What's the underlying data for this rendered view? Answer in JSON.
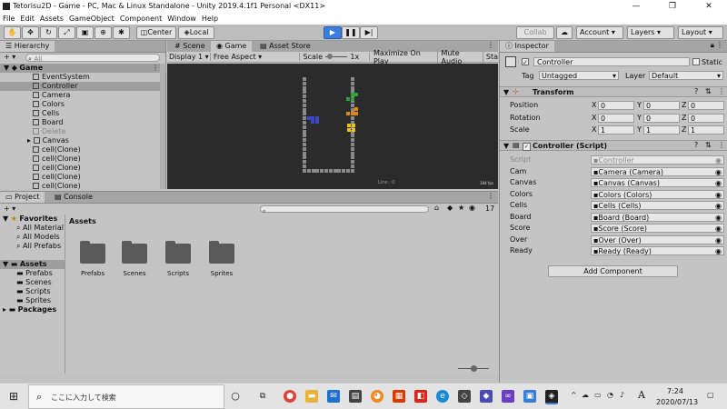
{
  "window": {
    "title": "Tetorisu2D - Game - PC, Mac & Linux Standalone - Unity 2019.4.1f1 Personal <DX11>"
  },
  "menu": [
    "File",
    "Edit",
    "Assets",
    "GameObject",
    "Component",
    "Window",
    "Help"
  ],
  "toolbar": {
    "center_label": "Center",
    "local_label": "Local",
    "collab_label": "Collab",
    "account_label": "Account",
    "layers_label": "Layers",
    "layout_label": "Layout"
  },
  "hierarchy": {
    "tab": "Hierarchy",
    "search_placeholder": "All",
    "scene": "Game",
    "items": [
      "EventSystem",
      "Controller",
      "Camera",
      "Colors",
      "Cells",
      "Board",
      "Delete",
      "Canvas",
      "cell(Clone)",
      "cell(Clone)",
      "cell(Clone)",
      "cell(Clone)",
      "cell(Clone)"
    ]
  },
  "center_tabs": {
    "scene": "Scene",
    "game": "Game",
    "store": "Asset Store"
  },
  "game_toolbar": {
    "display": "Display 1",
    "aspect": "Free Aspect",
    "scale_label": "Scale",
    "scale_value": "1x",
    "maximize": "Maximize On Play",
    "mute": "Mute Audio",
    "stats": "Sta"
  },
  "game_view": {
    "line_text": "Line : 0",
    "fps_text": "184 fps"
  },
  "project": {
    "tab": "Project",
    "console_tab": "Console",
    "count": "17",
    "favorites": {
      "label": "Favorites",
      "items": [
        "All Material",
        "All Models",
        "All Prefabs"
      ]
    },
    "assets_label": "Assets",
    "asset_tree": [
      "Prefabs",
      "Scenes",
      "Scripts",
      "Sprites"
    ],
    "packages_label": "Packages",
    "grid_header": "Assets",
    "folders": [
      "Prefabs",
      "Scenes",
      "Scripts",
      "Sprites"
    ]
  },
  "inspector": {
    "tab": "Inspector",
    "object_name": "Controller",
    "static_label": "Static",
    "tag_label": "Tag",
    "tag_value": "Untagged",
    "layer_label": "Layer",
    "layer_value": "Default",
    "transform": {
      "header": "Transform",
      "position": {
        "label": "Position",
        "x": "0",
        "y": "0",
        "z": "0"
      },
      "rotation": {
        "label": "Rotation",
        "x": "0",
        "y": "0",
        "z": "0"
      },
      "scale": {
        "label": "Scale",
        "x": "1",
        "y": "1",
        "z": "1"
      }
    },
    "script": {
      "header": "Controller (Script)",
      "fields": [
        {
          "label": "Script",
          "value": "Controller"
        },
        {
          "label": "Cam",
          "value": "Camera (Camera)"
        },
        {
          "label": "Canvas",
          "value": "Canvas (Canvas)"
        },
        {
          "label": "Colors",
          "value": "Colors (Colors)"
        },
        {
          "label": "Cells",
          "value": "Cells (Cells)"
        },
        {
          "label": "Board",
          "value": "Board (Board)"
        },
        {
          "label": "Score",
          "value": "Score (Score)"
        },
        {
          "label": "Over",
          "value": "Over (Over)"
        },
        {
          "label": "Ready",
          "value": "Ready (Ready)"
        }
      ]
    },
    "add_component": "Add Component"
  },
  "taskbar": {
    "search_placeholder": "ここに入力して検索",
    "time": "7:24",
    "date": "2020/07/13",
    "ime": "A"
  },
  "colors": {
    "accent": "#3b7ddd",
    "piece_blue": "#3a48c4",
    "piece_green": "#2fa23a",
    "piece_orange": "#e08a16",
    "piece_yellow": "#e8c21a"
  }
}
